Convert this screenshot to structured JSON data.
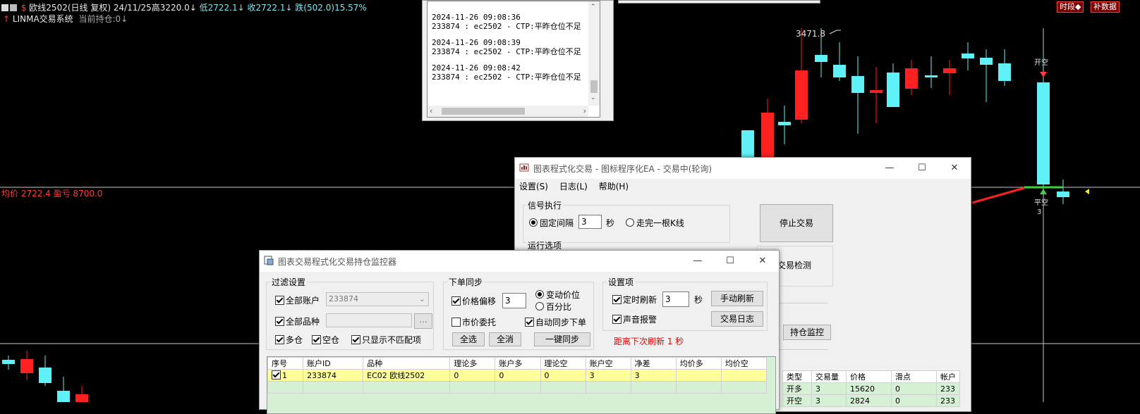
{
  "colors": {
    "up": "#ff2020",
    "down": "#5ff0f8",
    "background": "#000000",
    "avg_line": "#c8c8c8"
  },
  "chart_header": {
    "line1_prefix": "$",
    "line1": "欧线2502(日线 复权) 24/11/25",
    "high": "高3220.0↓",
    "low": "低2722.1↓",
    "close": "收2722.1↓",
    "change": "跌(502.0)15.57%",
    "line2_system": "LINMA交易系统",
    "line2_position": "当前持仓:0↓",
    "avg_price_text": "均价 2722.4 盈亏 8700.0",
    "high_marker": "3471.8",
    "signal_close_short": "平空",
    "signal_open": "开空",
    "signal_qty": "3",
    "signal_qty2": "3"
  },
  "top_buttons": [
    "时段◆",
    "补数据"
  ],
  "log_window": {
    "entries": [
      {
        "time": "2024-11-26 09:08:36",
        "msg": "233874 : ec2502 - CTP:平昨仓位不足"
      },
      {
        "time": "2024-11-26 09:08:39",
        "msg": "233874 : ec2502 - CTP:平昨仓位不足"
      },
      {
        "time": "2024-11-26 09:08:42",
        "msg": "233874 : ec2502 - CTP:平昨仓位不足"
      }
    ]
  },
  "ea_window": {
    "title": "图表程式化交易 - 图标程序化EA - 交易中(轮询)",
    "menu": [
      "设置(S)",
      "日志(L)",
      "帮助(H)"
    ],
    "signal_group": "信号执行",
    "fixed_interval": "固定间隔",
    "interval_value": "3",
    "seconds": "秒",
    "bar_end": "走完一根K线",
    "stop_button": "停止交易",
    "run_options": "运行选项",
    "trade_check": "交易检测",
    "position_monitor_button": "持仓监控",
    "table_headers": [
      "类型",
      "交易量",
      "价格",
      "滑点",
      "帐户"
    ],
    "table_rows": [
      [
        "开多",
        "3",
        "15620",
        "0",
        "233"
      ],
      [
        "开空",
        "3",
        "2824",
        "0",
        "233"
      ]
    ]
  },
  "monitor_window": {
    "title": "图表交易程式化交易持仓监控器",
    "filter_group": "过滤设置",
    "all_accounts": "全部账户",
    "account_value": "233874",
    "all_products": "全部品种",
    "product_value": "",
    "browse_button": "...",
    "long": "多仓",
    "short": "空仓",
    "only_mismatch": "只显示不匹配项",
    "order_sync_group": "下单同步",
    "price_offset": "价格偏移",
    "offset_value": "3",
    "tick_move": "变动价位",
    "percent": "百分比",
    "market_order": "市价委托",
    "auto_sync": "自动同步下单",
    "select_all": "全选",
    "full_sync": "全消",
    "one_key_sync": "一键同步",
    "settings_group": "设置项",
    "timer_refresh": "定时刷新",
    "refresh_value": "3",
    "seconds": "秒",
    "manual_refresh": "手动刷新",
    "sound_alarm": "声音报警",
    "trade_log": "交易日志",
    "next_refresh": "距离下次刷新 1 秒",
    "table_headers": [
      "序号",
      "账户ID",
      "品种",
      "理论多",
      "账户多",
      "理论空",
      "账户空",
      "净差",
      "均价多",
      "均价空"
    ],
    "rows": [
      [
        "1",
        "233874",
        "EC02 欧线2502",
        "0",
        "0",
        "0",
        "3",
        "3",
        "",
        ""
      ]
    ]
  },
  "chart_data": {
    "type": "candlestick",
    "note_series": "daily candles",
    "labels": [
      "3471.8"
    ],
    "avg_price": 2722.4
  }
}
